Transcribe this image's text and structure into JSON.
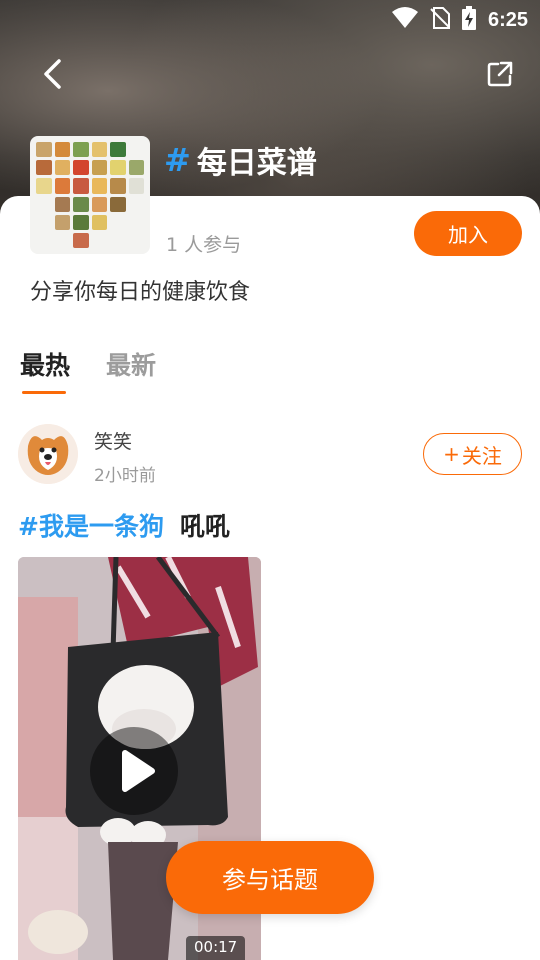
{
  "status_bar": {
    "time": "6:25"
  },
  "header": {
    "topic_hash": "#",
    "topic_title": "每日菜谱",
    "participants": "1 人参与",
    "join_label": "加入",
    "description": "分享你每日的健康饮食"
  },
  "tabs": [
    {
      "label": "最热",
      "active": true
    },
    {
      "label": "最新",
      "active": false
    }
  ],
  "post": {
    "author": "笑笑",
    "time": "2小时前",
    "follow_label": "关注",
    "tag": "#我是一条狗",
    "text": "吼吼",
    "video_duration": "00:17"
  },
  "fab_label": "参与话题",
  "colors": {
    "accent": "#fa6a08",
    "hashtag": "#2d9bf0"
  }
}
